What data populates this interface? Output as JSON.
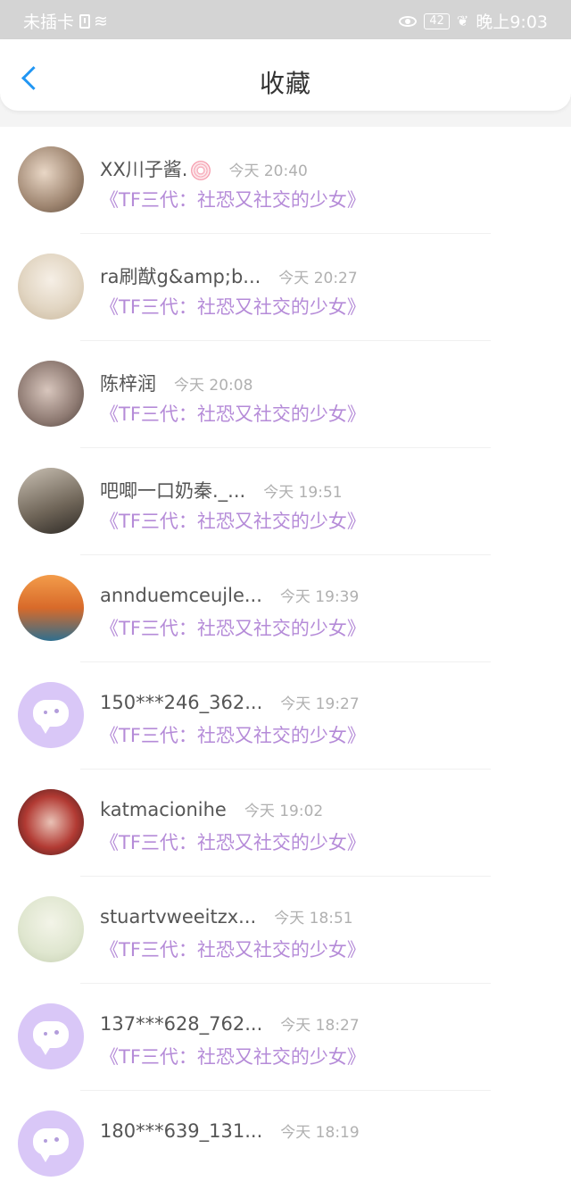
{
  "status_bar": {
    "carrier": "未插卡",
    "battery": "42",
    "time": "晚上9:03"
  },
  "header": {
    "title": "收藏"
  },
  "items": [
    {
      "name": "XX川子酱.",
      "time": "今天 20:40",
      "work": "《TF三代：社恐又社交的少女》",
      "avatar": "photo"
    },
    {
      "name": "ra刷猷g&amp;b...",
      "time": "今天 20:27",
      "work": "《TF三代：社恐又社交的少女》",
      "avatar": "photo"
    },
    {
      "name": "陈梓润",
      "time": "今天 20:08",
      "work": "《TF三代：社恐又社交的少女》",
      "avatar": "photo"
    },
    {
      "name": "吧唧一口奶秦._...",
      "time": "今天 19:51",
      "work": "《TF三代：社恐又社交的少女》",
      "avatar": "photo"
    },
    {
      "name": "annduemceujle...",
      "time": "今天 19:39",
      "work": "《TF三代：社恐又社交的少女》",
      "avatar": "photo"
    },
    {
      "name": "150***246_362...",
      "time": "今天 19:27",
      "work": "《TF三代：社恐又社交的少女》",
      "avatar": "default"
    },
    {
      "name": "katmacionihe",
      "time": "今天 19:02",
      "work": "《TF三代：社恐又社交的少女》",
      "avatar": "photo"
    },
    {
      "name": "stuartvweeitzx...",
      "time": "今天 18:51",
      "work": "《TF三代：社恐又社交的少女》",
      "avatar": "photo"
    },
    {
      "name": "137***628_762...",
      "time": "今天 18:27",
      "work": "《TF三代：社恐又社交的少女》",
      "avatar": "default"
    },
    {
      "name": "180***639_131...",
      "time": "今天 18:19",
      "work": "",
      "avatar": "default"
    }
  ],
  "colors": {
    "accent_blue": "#2196f3",
    "work_title": "#b58bd8",
    "default_avatar": "#d9c7f7"
  }
}
